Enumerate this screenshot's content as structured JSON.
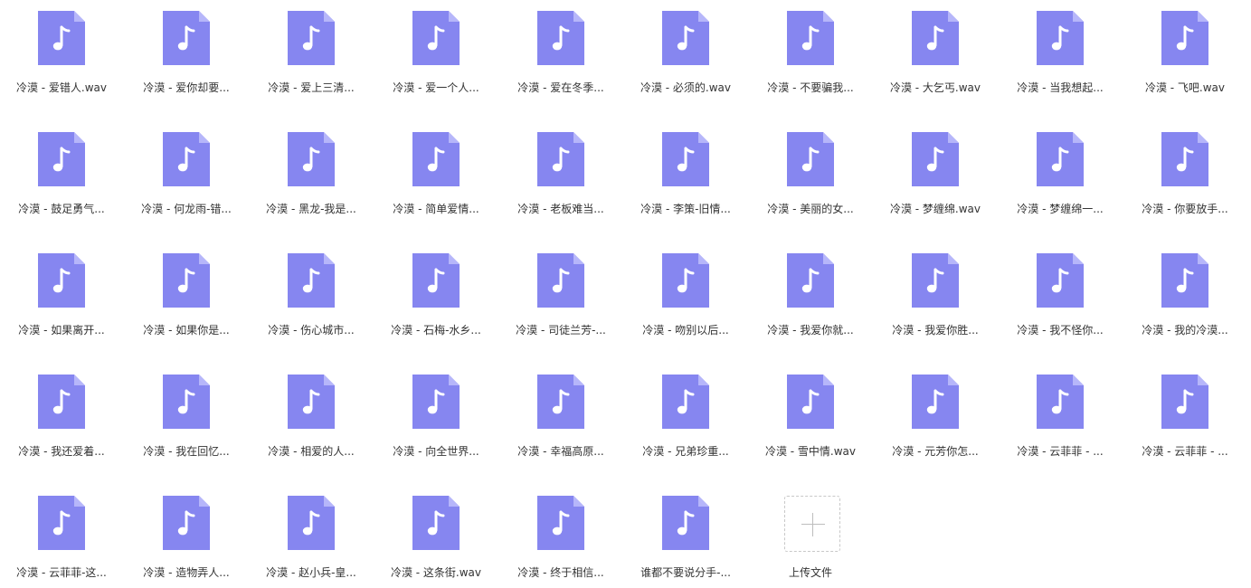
{
  "colors": {
    "icon_body": "#8686f0",
    "icon_fold": "#b6b6fa",
    "icon_glyph": "#ffffff",
    "label_text": "#333333",
    "upload_border": "#c8c8c8"
  },
  "icon_name": "music-file-icon",
  "files": [
    {
      "label": "冷漠 - 爱错人.wav"
    },
    {
      "label": "冷漠 - 爱你却要..."
    },
    {
      "label": "冷漠 - 爱上三清..."
    },
    {
      "label": "冷漠 - 爱一个人..."
    },
    {
      "label": "冷漠 - 爱在冬季..."
    },
    {
      "label": "冷漠 - 必须的.wav"
    },
    {
      "label": "冷漠 - 不要骗我..."
    },
    {
      "label": "冷漠 - 大乞丐.wav"
    },
    {
      "label": "冷漠 - 当我想起..."
    },
    {
      "label": "冷漠 - 飞吧.wav"
    },
    {
      "label": "冷漠 - 鼓足勇气..."
    },
    {
      "label": "冷漠 - 何龙雨-错..."
    },
    {
      "label": "冷漠 - 黑龙-我是..."
    },
    {
      "label": "冷漠 - 简单爱情..."
    },
    {
      "label": "冷漠 - 老板难当..."
    },
    {
      "label": "冷漠 - 李策-旧情..."
    },
    {
      "label": "冷漠 - 美丽的女..."
    },
    {
      "label": "冷漠 - 梦缠绵.wav"
    },
    {
      "label": "冷漠 - 梦缠绵一..."
    },
    {
      "label": "冷漠 - 你要放手..."
    },
    {
      "label": "冷漠 - 如果离开..."
    },
    {
      "label": "冷漠 - 如果你是..."
    },
    {
      "label": "冷漠 - 伤心城市..."
    },
    {
      "label": "冷漠 - 石梅-水乡..."
    },
    {
      "label": "冷漠 - 司徒兰芳-..."
    },
    {
      "label": "冷漠 - 吻别以后..."
    },
    {
      "label": "冷漠 - 我爱你就..."
    },
    {
      "label": "冷漠 - 我爱你胜..."
    },
    {
      "label": "冷漠 - 我不怪你..."
    },
    {
      "label": "冷漠 - 我的冷漠..."
    },
    {
      "label": "冷漠 - 我还爱着..."
    },
    {
      "label": "冷漠 - 我在回忆..."
    },
    {
      "label": "冷漠 - 相爱的人..."
    },
    {
      "label": "冷漠 - 向全世界..."
    },
    {
      "label": "冷漠 - 幸福高原..."
    },
    {
      "label": "冷漠 - 兄弟珍重..."
    },
    {
      "label": "冷漠 - 雪中情.wav"
    },
    {
      "label": "冷漠 - 元芳你怎..."
    },
    {
      "label": "冷漠 - 云菲菲 - ..."
    },
    {
      "label": "冷漠 - 云菲菲 - ..."
    },
    {
      "label": "冷漠 - 云菲菲-这..."
    },
    {
      "label": "冷漠 - 造物弄人..."
    },
    {
      "label": "冷漠 - 赵小兵-皇..."
    },
    {
      "label": "冷漠 - 这条街.wav"
    },
    {
      "label": "冷漠 - 终于相信..."
    },
    {
      "label": "谁都不要说分手-..."
    }
  ],
  "upload": {
    "label": "上传文件",
    "icon_name": "plus-icon"
  }
}
